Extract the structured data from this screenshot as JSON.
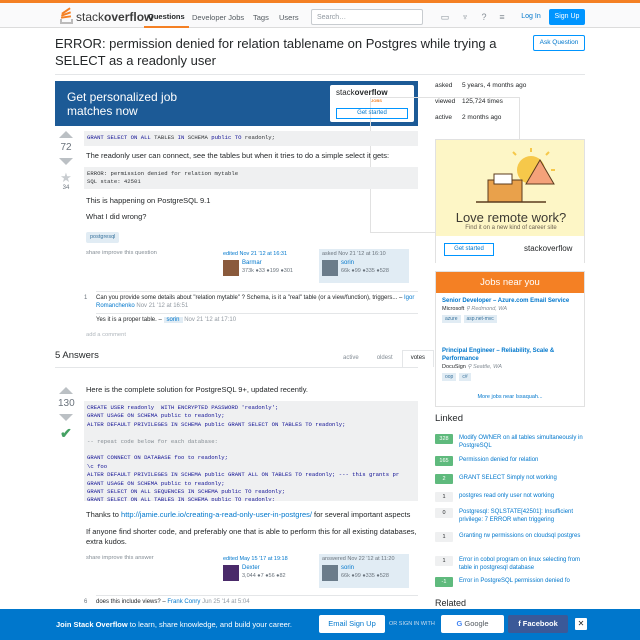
{
  "header": {
    "logo_regular": "stack",
    "logo_bold": "overflow",
    "nav": [
      "Questions",
      "Developer Jobs",
      "Tags",
      "Users"
    ],
    "search_placeholder": "Search…",
    "login": "Log In",
    "signup": "Sign Up",
    "icons": [
      "inbox-icon",
      "trophy-icon",
      "help-icon",
      "review-icon"
    ]
  },
  "question": {
    "title": "ERROR: permission denied for relation tablename on Postgres while trying a SELECT as a readonly user",
    "ask_button": "Ask Question",
    "votes": "72",
    "favorites": "34",
    "code1": "GRANT SELECT ON ALL TABLES IN SCHEMA public TO readonly;",
    "text1": "The readonly user can connect, see the tables but when it tries to do a simple select it gets:",
    "code2_line1": "ERROR: permission denied for relation mytable",
    "code2_line2": "SQL state: 42501",
    "text2": "This is happening on PostgreSQL 9.1",
    "text3": "What I did wrong?",
    "tag": "postgresql",
    "actions": "share  improve this question",
    "edited": {
      "time": "edited Nov 21 '12 at 16:31",
      "name": "Barmar",
      "rep": "373k  ●33  ●199  ●301"
    },
    "asked": {
      "time": "asked Nov 21 '12 at 16:10",
      "name": "sorin",
      "rep": "66k  ●99  ●335  ●528"
    },
    "comments": [
      {
        "count": "1",
        "text": "Can you provide some details about \"relation mytable\" ? Schema, is it a \"real\" table (or a view/function), triggers... –",
        "user": "Igor Romanchenko",
        "date": "Nov 21 '12 at 16:51"
      },
      {
        "count": "",
        "text": "Yes it is a proper table. –",
        "user": "sorin",
        "date": "Nov 21 '12 at 17:10"
      }
    ],
    "add_comment": "add a comment"
  },
  "answers_header": "5 Answers",
  "sort_tabs": [
    "active",
    "oldest",
    "votes"
  ],
  "answer": {
    "votes": "130",
    "intro": "Here is the complete solution for PostgreSQL 9+, updated recently.",
    "code_lines": [
      "CREATE USER readonly  WITH ENCRYPTED PASSWORD 'readonly';",
      "GRANT USAGE ON SCHEMA public to readonly;",
      "ALTER DEFAULT PRIVILEGES IN SCHEMA public GRANT SELECT ON TABLES TO readonly;",
      "",
      "-- repeat code below for each database:",
      "",
      "GRANT CONNECT ON DATABASE foo to readonly;",
      "\\c foo",
      "ALTER DEFAULT PRIVILEGES IN SCHEMA public GRANT ALL ON TABLES TO readonly; --- this grants pr",
      "GRANT USAGE ON SCHEMA public to readonly;",
      "GRANT SELECT ON ALL SEQUENCES IN SCHEMA public TO readonly;",
      "GRANT SELECT ON ALL TABLES IN SCHEMA public TO readonly;"
    ],
    "thanks_prefix": "Thanks to",
    "thanks_link": "http://jamie.curle.io/creating-a-read-only-user-in-postgres/",
    "thanks_suffix": "for several important aspects",
    "text2": "If anyone find shorter code, and preferably one that is able to perform this for all existing databases, extra kudos.",
    "actions": "share  improve this answer",
    "edited": {
      "time": "edited May 15 '17 at 19:18",
      "name": "Dexter",
      "rep": "3,044  ●7  ●56  ●82"
    },
    "answered": {
      "time": "answered Nov 22 '12 at 11:20",
      "name": "sorin",
      "rep": "66k  ●99  ●335  ●528"
    },
    "comment": {
      "count": "6",
      "text": "does this include views? –",
      "user": "Frank Conry",
      "date": "Jun 25 '14 at 5:04"
    }
  },
  "sidebar": {
    "meta": [
      {
        "label": "asked",
        "value": "5 years, 4 months ago"
      },
      {
        "label": "viewed",
        "value": "125,724 times"
      },
      {
        "label": "active",
        "value": "2 months ago"
      }
    ],
    "ad_top": {
      "headline": "Get personalized job matches now",
      "logo": "stackoverflow",
      "jobs": "JOBS",
      "cta": "Get started"
    },
    "remote_ad": {
      "title": "Love remote work?",
      "subtitle": "Find it on a new kind of career site",
      "cta": "Get started",
      "logo": "stackoverflow"
    },
    "jobs": {
      "header": "Jobs near you",
      "items": [
        {
          "title": "Senior Developer – Azure.com Email Service",
          "company": "Microsoft",
          "location": "Redmond, WA",
          "tags": [
            "azure",
            "asp.net-mvc"
          ]
        },
        {
          "title": "Principal Engineer – Reliability, Scale & Performance",
          "company": "DocuSign",
          "location": "Seattle, WA",
          "tags": [
            "oop",
            "c#"
          ]
        }
      ],
      "more": "More jobs near Issaquah..."
    },
    "linked_header": "Linked",
    "linked": [
      {
        "n": "328",
        "accepted": true,
        "text": "Modify OWNER on all tables simultaneously in PostgreSQL"
      },
      {
        "n": "165",
        "accepted": true,
        "text": "Permission denied for relation"
      },
      {
        "n": "2",
        "accepted": true,
        "text": "GRANT SELECT Simply not working"
      },
      {
        "n": "1",
        "accepted": false,
        "text": "postgres read only user not working"
      },
      {
        "n": "0",
        "accepted": false,
        "text": "Postgresql: SQLSTATE[42501]: Insufficient privilege: 7 ERROR when triggering"
      },
      {
        "n": "1",
        "accepted": false,
        "text": "Granting rw permissions on cloudsql postgres"
      },
      {
        "n": "1",
        "accepted": false,
        "text": "Error in cobol program on linux selecting from table in postgresql database"
      },
      {
        "n": "-1",
        "accepted": true,
        "text": "Error in PostgreSQL permission denied fo"
      }
    ],
    "related_header": "Related"
  },
  "footer": {
    "bold": "Join Stack Overflow",
    "text": "to learn, share knowledge, and build your career.",
    "email": "Email Sign Up",
    "or": "OR SIGN IN WITH",
    "google": "Google",
    "facebook": "Facebook",
    "close": "✕"
  },
  "colors": {
    "accent": "#f48024",
    "link": "#0077cc",
    "button": "#0095ff",
    "accepted": "#5fba7d"
  }
}
